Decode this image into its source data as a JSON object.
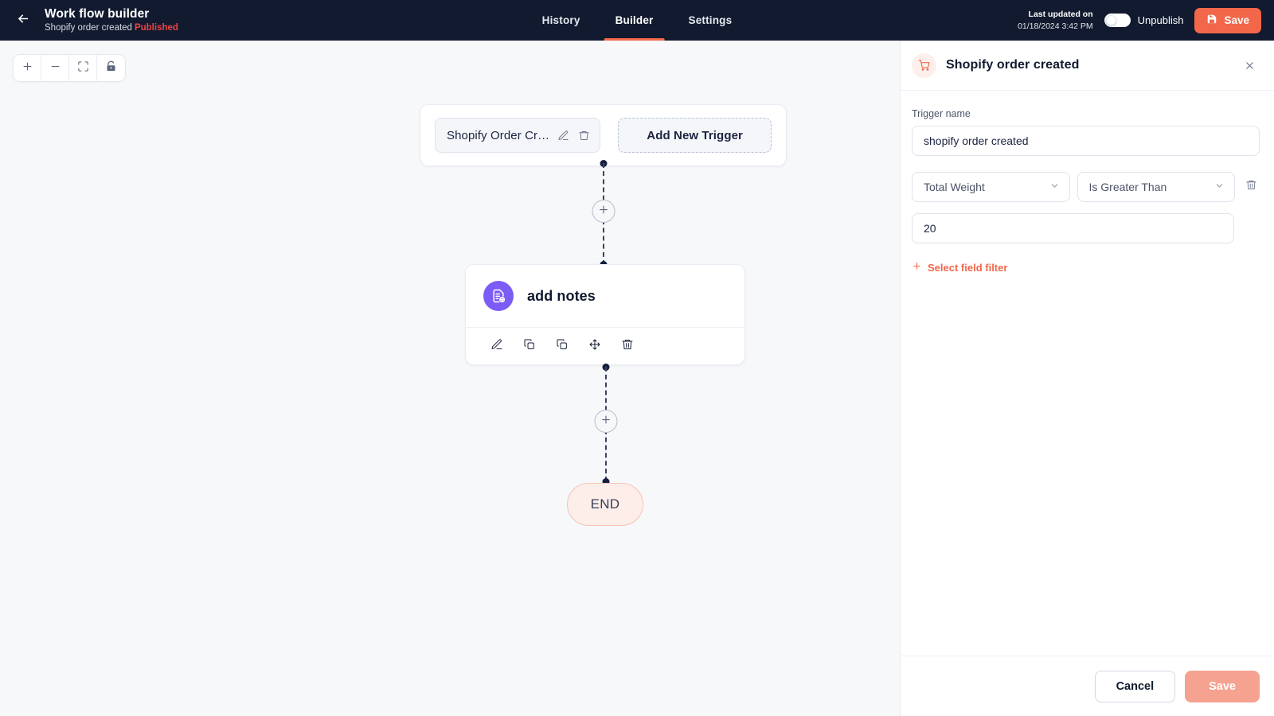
{
  "header": {
    "back_icon": "arrow-left-icon",
    "title": "Work flow builder",
    "subtitle": "Shopify order created",
    "status_badge": "Published",
    "tabs": [
      {
        "label": "History",
        "active": false
      },
      {
        "label": "Builder",
        "active": true
      },
      {
        "label": "Settings",
        "active": false
      }
    ],
    "last_updated_label": "Last updated on",
    "last_updated_value": "01/18/2024 3:42 PM",
    "publish_toggle_label": "Unpublish",
    "publish_toggle_on": true,
    "save_label": "Save",
    "save_icon": "floppy-disk-icon",
    "accent_color": "#f2674a",
    "bar_color": "#111a2e"
  },
  "canvas": {
    "background": "#f7f8fa",
    "toolbar": [
      {
        "name": "zoom-in-button",
        "icon": "plus-icon"
      },
      {
        "name": "zoom-out-button",
        "icon": "minus-icon"
      },
      {
        "name": "fit-view-button",
        "icon": "fullscreen-icon"
      },
      {
        "name": "lock-canvas-button",
        "icon": "lock-icon"
      }
    ],
    "trigger_card": {
      "chip_label": "Shopify Order Cr…",
      "chip_edit_icon": "pencil-icon",
      "chip_delete_icon": "trash-icon",
      "add_trigger_label": "Add New Trigger"
    },
    "action_node": {
      "title": "add notes",
      "icon": "note-add-icon",
      "icon_color": "#7b5cf5",
      "actions": [
        {
          "name": "edit-node-button",
          "icon": "pencil-icon"
        },
        {
          "name": "copy-node-button",
          "icon": "copy-icon"
        },
        {
          "name": "duplicate-node-button",
          "icon": "duplicate-icon"
        },
        {
          "name": "move-node-button",
          "icon": "move-icon"
        },
        {
          "name": "delete-node-button",
          "icon": "trash-icon"
        }
      ]
    },
    "end_node": {
      "label": "END",
      "fill": "#fdeeea",
      "border": "#f6c3b6"
    },
    "add_step_icon": "plus-icon"
  },
  "panel": {
    "icon": "shopping-cart-icon",
    "title": "Shopify order created",
    "close_icon": "close-icon",
    "trigger_name_label": "Trigger name",
    "trigger_name_value": "shopify order created",
    "trigger_name_placeholder": "Trigger name",
    "condition": {
      "field_value": "Total Weight",
      "operator_value": "Is Greater Than",
      "value": "20",
      "value_placeholder": "Value",
      "delete_icon": "trash-icon",
      "chevron_icon": "chevron-down-icon"
    },
    "add_filter_label": "Select field filter",
    "add_filter_icon": "plus-icon",
    "cancel_label": "Cancel",
    "save_label": "Save",
    "save_disabled": true
  }
}
